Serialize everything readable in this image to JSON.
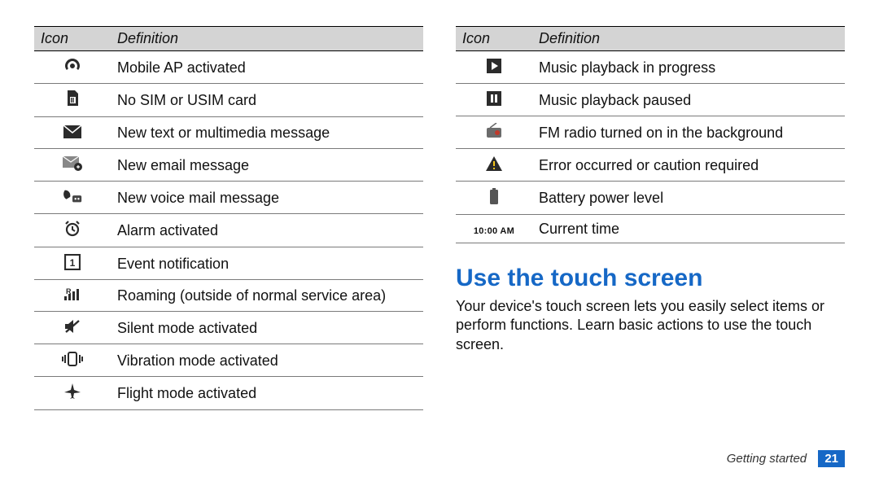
{
  "table_headers": {
    "icon": "Icon",
    "definition": "Definition"
  },
  "left_table": [
    {
      "def": "Mobile AP activated"
    },
    {
      "def": "No SIM or USIM card"
    },
    {
      "def": "New text or multimedia message"
    },
    {
      "def": "New email message"
    },
    {
      "def": "New voice mail message"
    },
    {
      "def": "Alarm activated"
    },
    {
      "def": "Event notification"
    },
    {
      "def": "Roaming (outside of normal service area)"
    },
    {
      "def": "Silent mode activated"
    },
    {
      "def": "Vibration mode activated"
    },
    {
      "def": "Flight mode activated"
    }
  ],
  "right_table": [
    {
      "def": "Music playback in progress"
    },
    {
      "def": "Music playback paused"
    },
    {
      "def": "FM radio turned on in the background"
    },
    {
      "def": "Error occurred or caution required"
    },
    {
      "def": "Battery power level"
    },
    {
      "def": "Current time",
      "time_text": "10:00 AM"
    }
  ],
  "heading": "Use the touch screen",
  "body": "Your device's touch screen lets you easily select items or perform functions. Learn basic actions to use the touch screen.",
  "footer": {
    "section": "Getting started",
    "page": "21"
  }
}
